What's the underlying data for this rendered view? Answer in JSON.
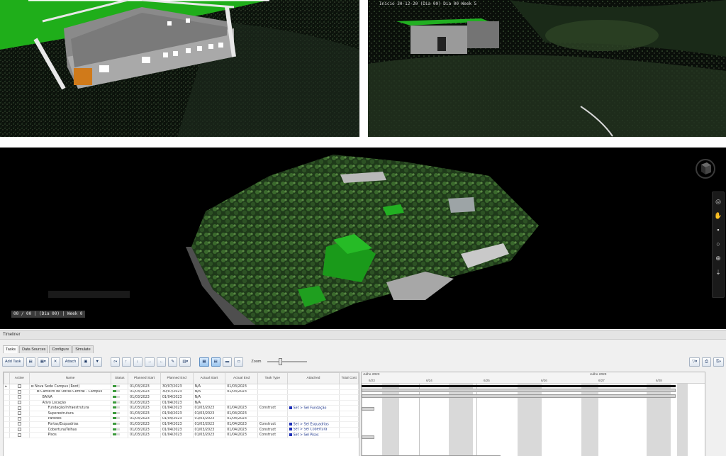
{
  "viewports": {
    "right_label": "Início 30-12-20 (Dia 00) Dia 00 Week 5",
    "main_status": "00 / 00 | (Dia 00) | Week 0"
  },
  "navbar": {
    "icons": [
      "globe-icon",
      "hand-pan-icon",
      "dot-icon",
      "orbit-icon",
      "zoom-icon",
      "walk-icon"
    ]
  },
  "timeliner": {
    "title": "Timeliner",
    "tabs": [
      "Tasks",
      "Data Sources",
      "Configure",
      "Simulate"
    ],
    "toolbar": {
      "add_task": "Add Task",
      "auto_attach": "Attach",
      "zoom_label": "Zoom"
    },
    "columns": [
      "Active",
      "Name",
      "Status",
      "Planned Start",
      "Planned End",
      "Actual Start",
      "Actual End",
      "Task Type",
      "Attached",
      "Total Cost"
    ],
    "rows": [
      {
        "name": "Nova Sede Campus (Root)",
        "indent": 0,
        "ps": "01/03/2023",
        "pe": "30/07/2023",
        "as": "N/A",
        "ae": "01/03/2023",
        "type": "",
        "attached": ""
      },
      {
        "name": "Canteiro de Obras Central - Campus",
        "indent": 1,
        "ps": "01/03/2023",
        "pe": "30/07/2023",
        "as": "N/A",
        "ae": "01/03/2023",
        "type": "",
        "attached": ""
      },
      {
        "name": "BAÍVA",
        "indent": 2,
        "ps": "01/03/2023",
        "pe": "01/04/2023",
        "as": "N/A",
        "ae": "",
        "type": "",
        "attached": ""
      },
      {
        "name": "Ativo Locação",
        "indent": 2,
        "ps": "01/03/2023",
        "pe": "01/04/2023",
        "as": "N/A",
        "ae": "",
        "type": "",
        "attached": ""
      },
      {
        "name": "Fundação/Infraestrutura",
        "indent": 3,
        "ps": "01/03/2023",
        "pe": "01/04/2023",
        "as": "01/03/2023",
        "ae": "01/04/2023",
        "type": "Construct",
        "attached": "Set > Sel Fundação"
      },
      {
        "name": "Superestrutura",
        "indent": 3,
        "ps": "01/03/2023",
        "pe": "01/04/2023",
        "as": "01/03/2023",
        "ae": "01/04/2023",
        "type": "",
        "attached": ""
      },
      {
        "name": "Paredes",
        "indent": 3,
        "ps": "01/03/2023",
        "pe": "01/04/2023",
        "as": "01/03/2023",
        "ae": "01/04/2023",
        "type": "",
        "attached": ""
      },
      {
        "name": "Portas/Esquadrias",
        "indent": 3,
        "ps": "01/03/2023",
        "pe": "01/04/2023",
        "as": "01/03/2023",
        "ae": "01/04/2023",
        "type": "Construct",
        "attached": "Set > Sel Esquadrias"
      },
      {
        "name": "Cobertura/Telhas",
        "indent": 3,
        "ps": "01/03/2023",
        "pe": "01/04/2023",
        "as": "01/03/2023",
        "ae": "01/04/2023",
        "type": "Construct",
        "attached": "Set > Sel Cobertura"
      },
      {
        "name": "Pisos",
        "indent": 3,
        "ps": "01/03/2023",
        "pe": "01/04/2023",
        "as": "01/03/2023",
        "ae": "01/04/2023",
        "type": "Construct",
        "attached": "Set > Sel Pisos"
      }
    ],
    "gantt": {
      "months": [
        "Julho 2023",
        "Julho 2023"
      ],
      "days": [
        "6/23",
        "6/24",
        "6/25",
        "6/26",
        "6/27",
        "6/28"
      ]
    }
  }
}
